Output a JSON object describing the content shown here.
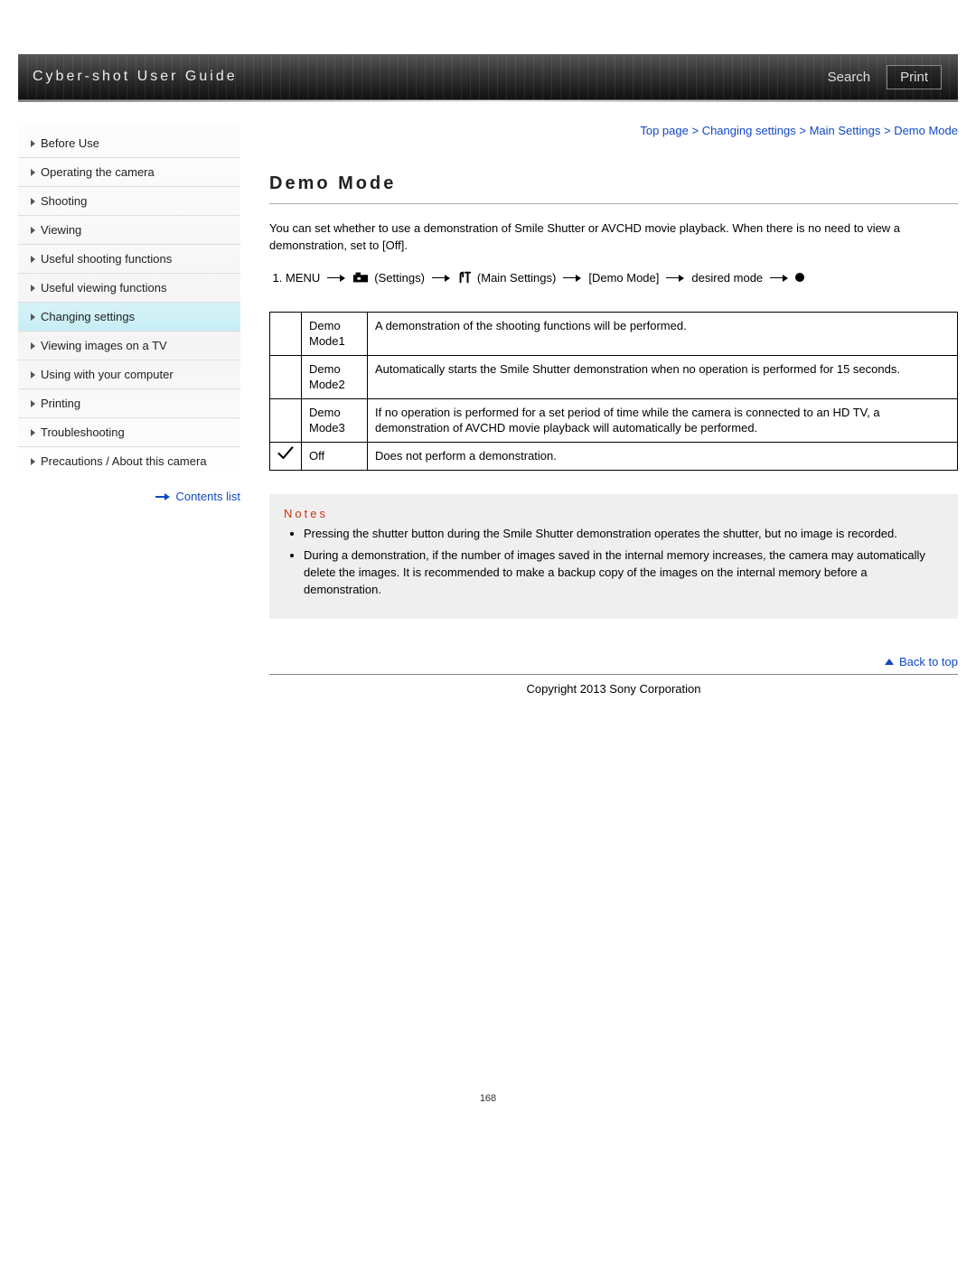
{
  "header": {
    "title": "Cyber-shot User Guide",
    "search": "Search",
    "print": "Print"
  },
  "breadcrumb": {
    "items": [
      "Top page",
      "Changing settings",
      "Main Settings",
      "Demo Mode"
    ]
  },
  "sidebar": {
    "items": [
      {
        "label": "Before Use"
      },
      {
        "label": "Operating the camera"
      },
      {
        "label": "Shooting"
      },
      {
        "label": "Viewing"
      },
      {
        "label": "Useful shooting functions"
      },
      {
        "label": "Useful viewing functions"
      },
      {
        "label": "Changing settings",
        "active": true
      },
      {
        "label": "Viewing images on a TV"
      },
      {
        "label": "Using with your computer"
      },
      {
        "label": "Printing"
      },
      {
        "label": "Troubleshooting"
      },
      {
        "label": "Precautions / About this camera"
      }
    ],
    "contents_link": "Contents list"
  },
  "main": {
    "title": "Demo Mode",
    "intro": "You can set whether to use a demonstration of Smile Shutter or AVCHD movie playback. When there is no need to view a demonstration, set to [Off].",
    "step": {
      "menu": "MENU",
      "settings": "(Settings)",
      "main_settings": "(Main Settings)",
      "demo_mode": "[Demo Mode]",
      "desired": "desired mode"
    },
    "options": [
      {
        "check": false,
        "name": "Demo Mode1",
        "desc": "A demonstration of the shooting functions will be performed."
      },
      {
        "check": false,
        "name": "Demo Mode2",
        "desc": "Automatically starts the Smile Shutter demonstration when no operation is performed for 15 seconds."
      },
      {
        "check": false,
        "name": "Demo Mode3",
        "desc": "If no operation is performed for a set period of time while the camera is connected to an HD TV, a demonstration of AVCHD movie playback will automatically be performed."
      },
      {
        "check": true,
        "name": "Off",
        "desc": "Does not perform a demonstration."
      }
    ],
    "notes_heading": "Notes",
    "notes": [
      "Pressing the shutter button during the Smile Shutter demonstration operates the shutter, but no image is recorded.",
      "During a demonstration, if the number of images saved in the internal memory increases, the camera may automatically delete the images. It is recommended to make a backup copy of the images on the internal memory before a demonstration."
    ],
    "back_to_top": "Back to top"
  },
  "footer": {
    "copyright": "Copyright 2013 Sony Corporation",
    "page_number": "168"
  }
}
